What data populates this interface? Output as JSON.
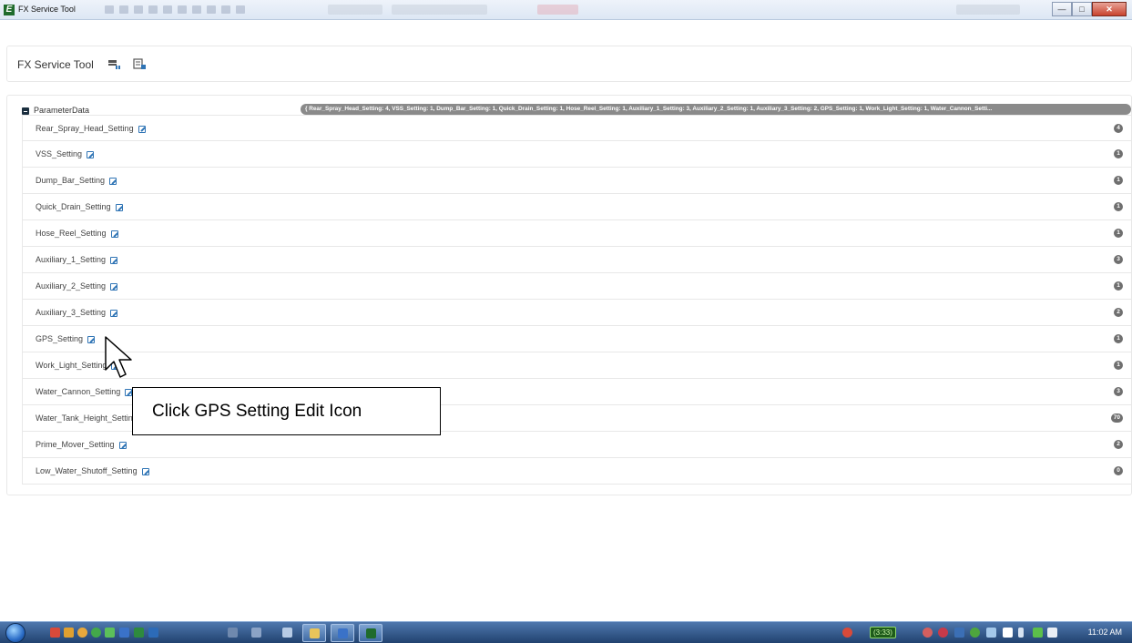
{
  "window": {
    "title": "FX Service Tool",
    "controls": {
      "minimize": "—",
      "maximize": "□",
      "close": "✕"
    }
  },
  "header": {
    "brand": "FX Service Tool",
    "icons": [
      "save-settings-icon",
      "read-settings-icon"
    ]
  },
  "tree": {
    "root_label": "ParameterData",
    "summary": "{ Rear_Spray_Head_Setting: 4, VSS_Setting: 1, Dump_Bar_Setting: 1, Quick_Drain_Setting: 1, Hose_Reel_Setting: 1, Auxiliary_1_Setting: 3, Auxiliary_2_Setting: 1, Auxiliary_3_Setting: 2, GPS_Setting: 1, Work_Light_Setting: 1, Water_Cannon_Setti...",
    "items": [
      {
        "label": "Rear_Spray_Head_Setting",
        "count": "4"
      },
      {
        "label": "VSS_Setting",
        "count": "1"
      },
      {
        "label": "Dump_Bar_Setting",
        "count": "1"
      },
      {
        "label": "Quick_Drain_Setting",
        "count": "1"
      },
      {
        "label": "Hose_Reel_Setting",
        "count": "1"
      },
      {
        "label": "Auxiliary_1_Setting",
        "count": "3"
      },
      {
        "label": "Auxiliary_2_Setting",
        "count": "1"
      },
      {
        "label": "Auxiliary_3_Setting",
        "count": "2"
      },
      {
        "label": "GPS_Setting",
        "count": "1"
      },
      {
        "label": "Work_Light_Setting",
        "count": "1"
      },
      {
        "label": "Water_Cannon_Setting",
        "count": "3"
      },
      {
        "label": "Water_Tank_Height_Setting",
        "count": "70"
      },
      {
        "label": "Prime_Mover_Setting",
        "count": "2"
      },
      {
        "label": "Low_Water_Shutoff_Setting",
        "count": "0"
      }
    ]
  },
  "tutorial": {
    "callout": "Click GPS Setting Edit Icon"
  },
  "taskbar": {
    "battery": "(3:33)",
    "clock": "11:02 AM"
  },
  "colors": {
    "accent": "#2f74b5",
    "badge": "#6f6f6f",
    "taskbar": "#21426f"
  }
}
